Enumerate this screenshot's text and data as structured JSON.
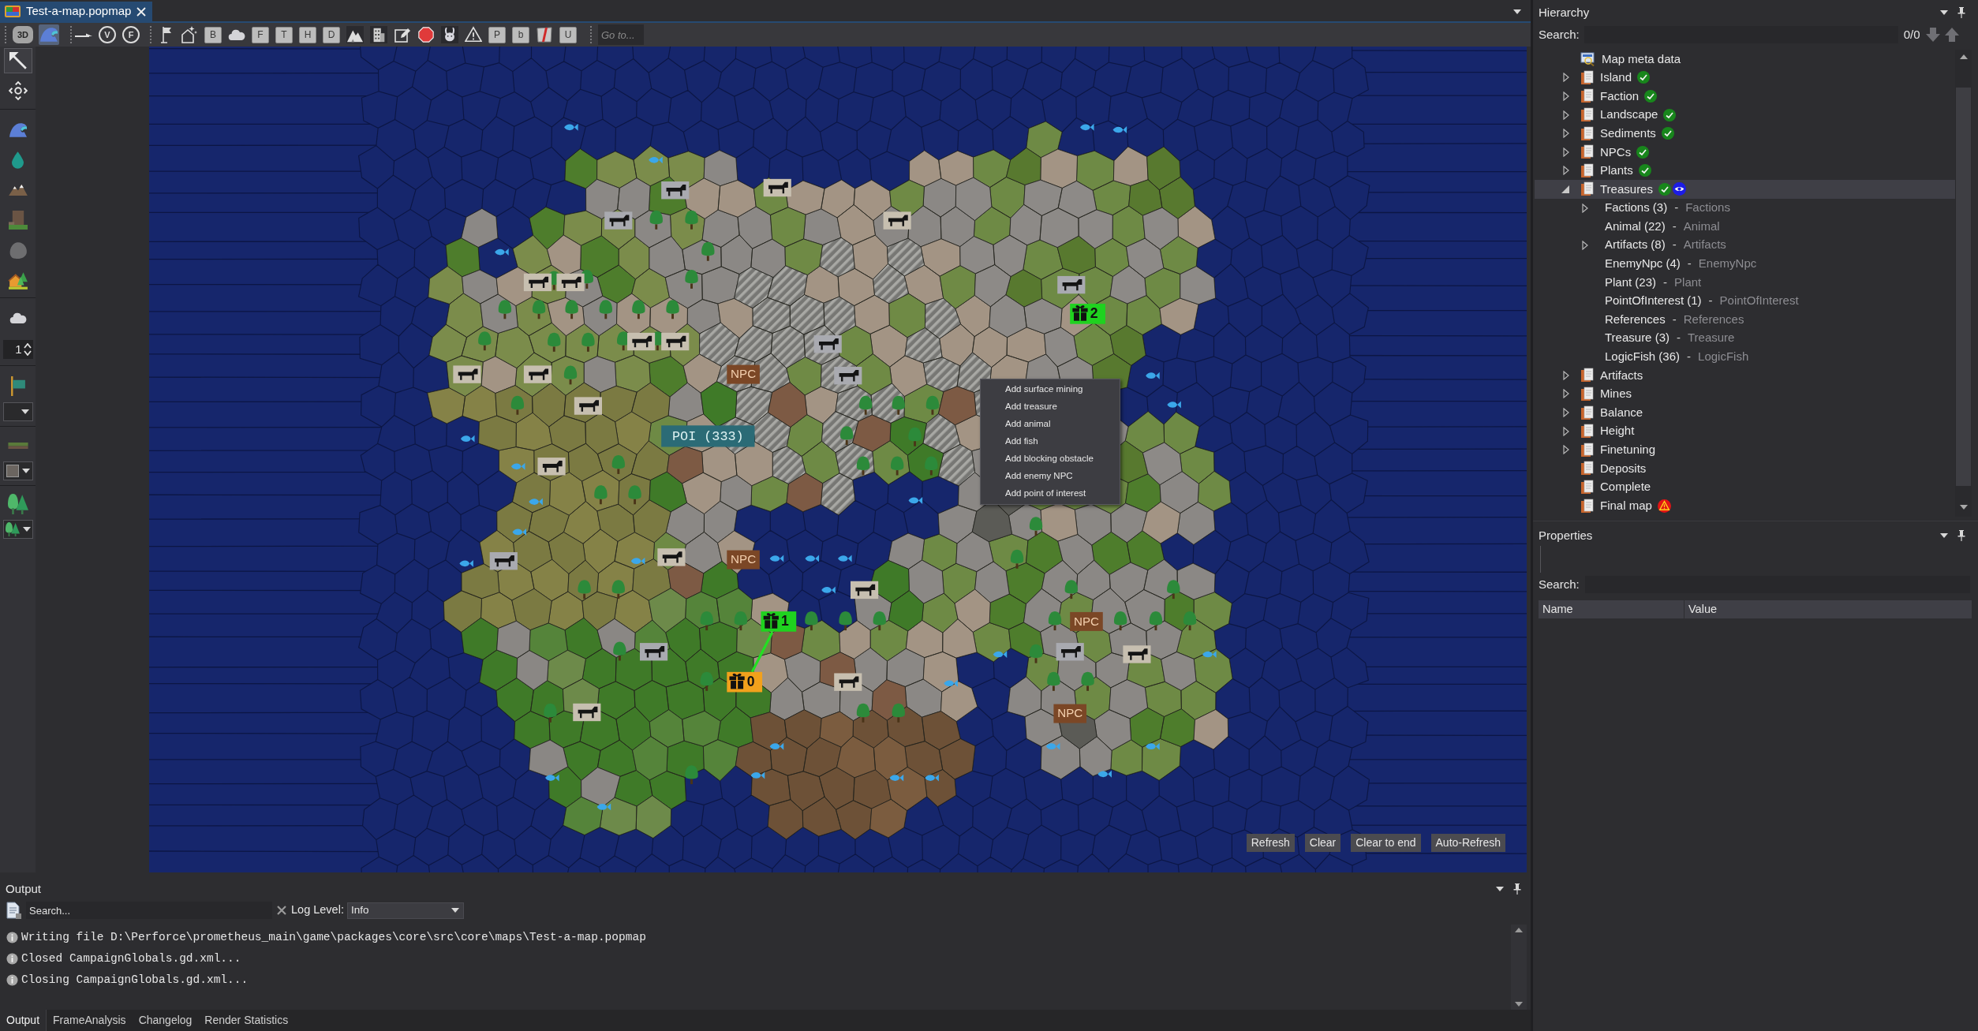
{
  "document_tab": {
    "title": "Test-a-map.popmap",
    "selected": true
  },
  "toolbar_groups": [
    {
      "buttons": [
        {
          "kind": "cube",
          "text": "3D",
          "selected": false
        },
        {
          "kind": "wave",
          "selected": true
        }
      ]
    },
    {
      "buttons": [
        {
          "kind": "line",
          "selected": false
        },
        {
          "kind": "circle",
          "text": "V",
          "selected": false
        },
        {
          "kind": "circle",
          "text": "F",
          "selected": false
        }
      ]
    },
    {
      "buttons": [
        {
          "kind": "flag",
          "selected": false
        },
        {
          "kind": "house-sparkle",
          "selected": false
        },
        {
          "kind": "sheet",
          "text": "B",
          "selected": false
        },
        {
          "kind": "cloud",
          "selected": false
        },
        {
          "kind": "sheet",
          "text": "F",
          "selected": false
        },
        {
          "kind": "sheet",
          "text": "T",
          "selected": false
        },
        {
          "kind": "sheet",
          "text": "H",
          "selected": false
        },
        {
          "kind": "sheet",
          "text": "D",
          "selected": false
        },
        {
          "kind": "mountains",
          "selected": false
        },
        {
          "kind": "building",
          "selected": false
        },
        {
          "kind": "edit",
          "selected": false
        },
        {
          "kind": "stop",
          "selected": false
        },
        {
          "kind": "rabbit",
          "selected": false
        },
        {
          "kind": "warning",
          "selected": false
        },
        {
          "kind": "sheet",
          "text": "P",
          "selected": false
        },
        {
          "kind": "sheet",
          "text": "b",
          "selected": false
        },
        {
          "kind": "sheet-red",
          "selected": false
        },
        {
          "kind": "sheet",
          "text": "U",
          "selected": false
        }
      ]
    }
  ],
  "goto_field": {
    "placeholder": "Go to..."
  },
  "tool_groups": [
    {
      "items": [
        {
          "kind": "pointer",
          "selected": true
        },
        {
          "kind": "move",
          "selected": false
        }
      ]
    },
    {
      "items": [
        {
          "kind": "wave",
          "selected": false
        },
        {
          "kind": "drop",
          "selected": false
        },
        {
          "kind": "peaks",
          "selected": false
        },
        {
          "kind": "cliff",
          "selected": false
        },
        {
          "kind": "rock",
          "selected": false
        },
        {
          "kind": "house",
          "selected": false
        }
      ]
    },
    {
      "items": [
        {
          "kind": "cloud",
          "selected": false
        },
        {
          "kind": "spinner",
          "value": "1"
        }
      ]
    },
    {
      "items": [
        {
          "kind": "banner",
          "selected": false
        },
        {
          "kind": "dropdown"
        }
      ]
    },
    {
      "items": [
        {
          "kind": "ground",
          "selected": false
        },
        {
          "kind": "color-dropdown"
        }
      ]
    },
    {
      "items": [
        {
          "kind": "trees",
          "selected": false
        },
        {
          "kind": "trees-dropdown"
        }
      ]
    }
  ],
  "map": {
    "labels": [
      {
        "kind": "npc",
        "text": "NPC"
      },
      {
        "kind": "poi",
        "text": "POI (333)"
      },
      {
        "kind": "npc",
        "text": "NPC"
      },
      {
        "kind": "npc",
        "text": "NPC"
      },
      {
        "kind": "npc",
        "text": "NPC"
      }
    ],
    "treasures": [
      {
        "text": "2",
        "color": "#1fd21f"
      },
      {
        "text": "1",
        "color": "#1fd21f"
      },
      {
        "text": "0",
        "color": "#f2a11c"
      }
    ],
    "context_menu": [
      "Add surface mining",
      "Add treasure",
      "Add animal",
      "Add fish",
      "Add blocking obstacle",
      "Add enemy NPC",
      "Add point of interest"
    ],
    "buttons": [
      "Refresh",
      "Clear",
      "Clear to end",
      "Auto-Refresh"
    ]
  },
  "output": {
    "title": "Output",
    "search": {
      "placeholder": "Search..."
    },
    "log_level": {
      "label": "Log Level:",
      "value": "Info"
    },
    "lines": [
      {
        "kind": "info",
        "text": "Writing file D:\\Perforce\\prometheus_main\\game\\packages\\core\\src\\core\\maps\\Test-a-map.popmap"
      },
      {
        "kind": "info",
        "text": "Closed CampaignGlobals.gd.xml..."
      },
      {
        "kind": "info",
        "text": "Closing CampaignGlobals.gd.xml..."
      }
    ],
    "tabs": [
      {
        "label": "Output",
        "selected": true
      },
      {
        "label": "FrameAnalysis",
        "selected": false
      },
      {
        "label": "Changelog",
        "selected": false
      },
      {
        "label": "Render Statistics",
        "selected": false
      }
    ]
  },
  "hierarchy": {
    "title": "Hierarchy",
    "search": {
      "label": "Search:",
      "count": "0/0"
    },
    "items": [
      {
        "kind": "meta",
        "label": "Map meta data",
        "expandable": false,
        "done": false,
        "warning": false,
        "visible": false,
        "selected": false
      },
      {
        "kind": "layer",
        "label": "Island",
        "expandable": true,
        "expanded": false,
        "done": true,
        "warning": false,
        "visible": false,
        "selected": false
      },
      {
        "kind": "layer",
        "label": "Faction",
        "expandable": true,
        "expanded": false,
        "done": true,
        "warning": false,
        "visible": false,
        "selected": false
      },
      {
        "kind": "layer",
        "label": "Landscape",
        "expandable": true,
        "expanded": false,
        "done": true,
        "warning": false,
        "visible": false,
        "selected": false
      },
      {
        "kind": "layer",
        "label": "Sediments",
        "expandable": true,
        "expanded": false,
        "done": true,
        "warning": false,
        "visible": false,
        "selected": false
      },
      {
        "kind": "layer",
        "label": "NPCs",
        "expandable": true,
        "expanded": false,
        "done": true,
        "warning": false,
        "visible": false,
        "selected": false
      },
      {
        "kind": "layer",
        "label": "Plants",
        "expandable": true,
        "expanded": false,
        "done": true,
        "warning": false,
        "visible": false,
        "selected": false
      },
      {
        "kind": "layer",
        "label": "Treasures",
        "expandable": true,
        "expanded": true,
        "done": true,
        "warning": false,
        "visible": true,
        "selected": true,
        "children": [
          {
            "name": "Factions (3)",
            "separator": "-",
            "type": "Factions",
            "expandable": true,
            "expanded": false,
            "selected": false
          },
          {
            "name": "Animal (22)",
            "separator": "-",
            "type": "Animal",
            "expandable": false,
            "selected": false
          },
          {
            "name": "Artifacts (8)",
            "separator": "-",
            "type": "Artifacts",
            "expandable": true,
            "expanded": false,
            "selected": false
          },
          {
            "name": "EnemyNpc (4)",
            "separator": "-",
            "type": "EnemyNpc",
            "expandable": false,
            "selected": false
          },
          {
            "name": "Plant (23)",
            "separator": "-",
            "type": "Plant",
            "expandable": false,
            "selected": false
          },
          {
            "name": "PointOfInterest (1)",
            "separator": "-",
            "type": "PointOfInterest",
            "expandable": false,
            "selected": false
          },
          {
            "name": "References",
            "separator": "-",
            "type": "References",
            "expandable": false,
            "selected": false
          },
          {
            "name": "Treasure (3)",
            "separator": "-",
            "type": "Treasure",
            "expandable": false,
            "selected": false
          },
          {
            "name": "LogicFish (36)",
            "separator": "-",
            "type": "LogicFish",
            "expandable": false,
            "selected": false
          }
        ]
      },
      {
        "kind": "layer",
        "label": "Artifacts",
        "expandable": true,
        "expanded": false,
        "done": false,
        "warning": false,
        "visible": false,
        "selected": false
      },
      {
        "kind": "layer",
        "label": "Mines",
        "expandable": true,
        "expanded": false,
        "done": false,
        "warning": false,
        "visible": false,
        "selected": false
      },
      {
        "kind": "layer",
        "label": "Balance",
        "expandable": true,
        "expanded": false,
        "done": false,
        "warning": false,
        "visible": false,
        "selected": false
      },
      {
        "kind": "layer",
        "label": "Height",
        "expandable": true,
        "expanded": false,
        "done": false,
        "warning": false,
        "visible": false,
        "selected": false
      },
      {
        "kind": "layer",
        "label": "Finetuning",
        "expandable": true,
        "expanded": false,
        "done": false,
        "warning": false,
        "visible": false,
        "selected": false
      },
      {
        "kind": "layer",
        "label": "Deposits",
        "expandable": false,
        "done": false,
        "warning": false,
        "visible": false,
        "selected": false
      },
      {
        "kind": "layer",
        "label": "Complete",
        "expandable": false,
        "done": false,
        "warning": false,
        "visible": false,
        "selected": false
      },
      {
        "kind": "layer",
        "label": "Final map",
        "expandable": false,
        "done": false,
        "warning": true,
        "visible": false,
        "selected": false
      }
    ]
  },
  "properties": {
    "title": "Properties",
    "search": {
      "label": "Search:"
    },
    "columns": [
      "Name",
      "Value"
    ]
  }
}
